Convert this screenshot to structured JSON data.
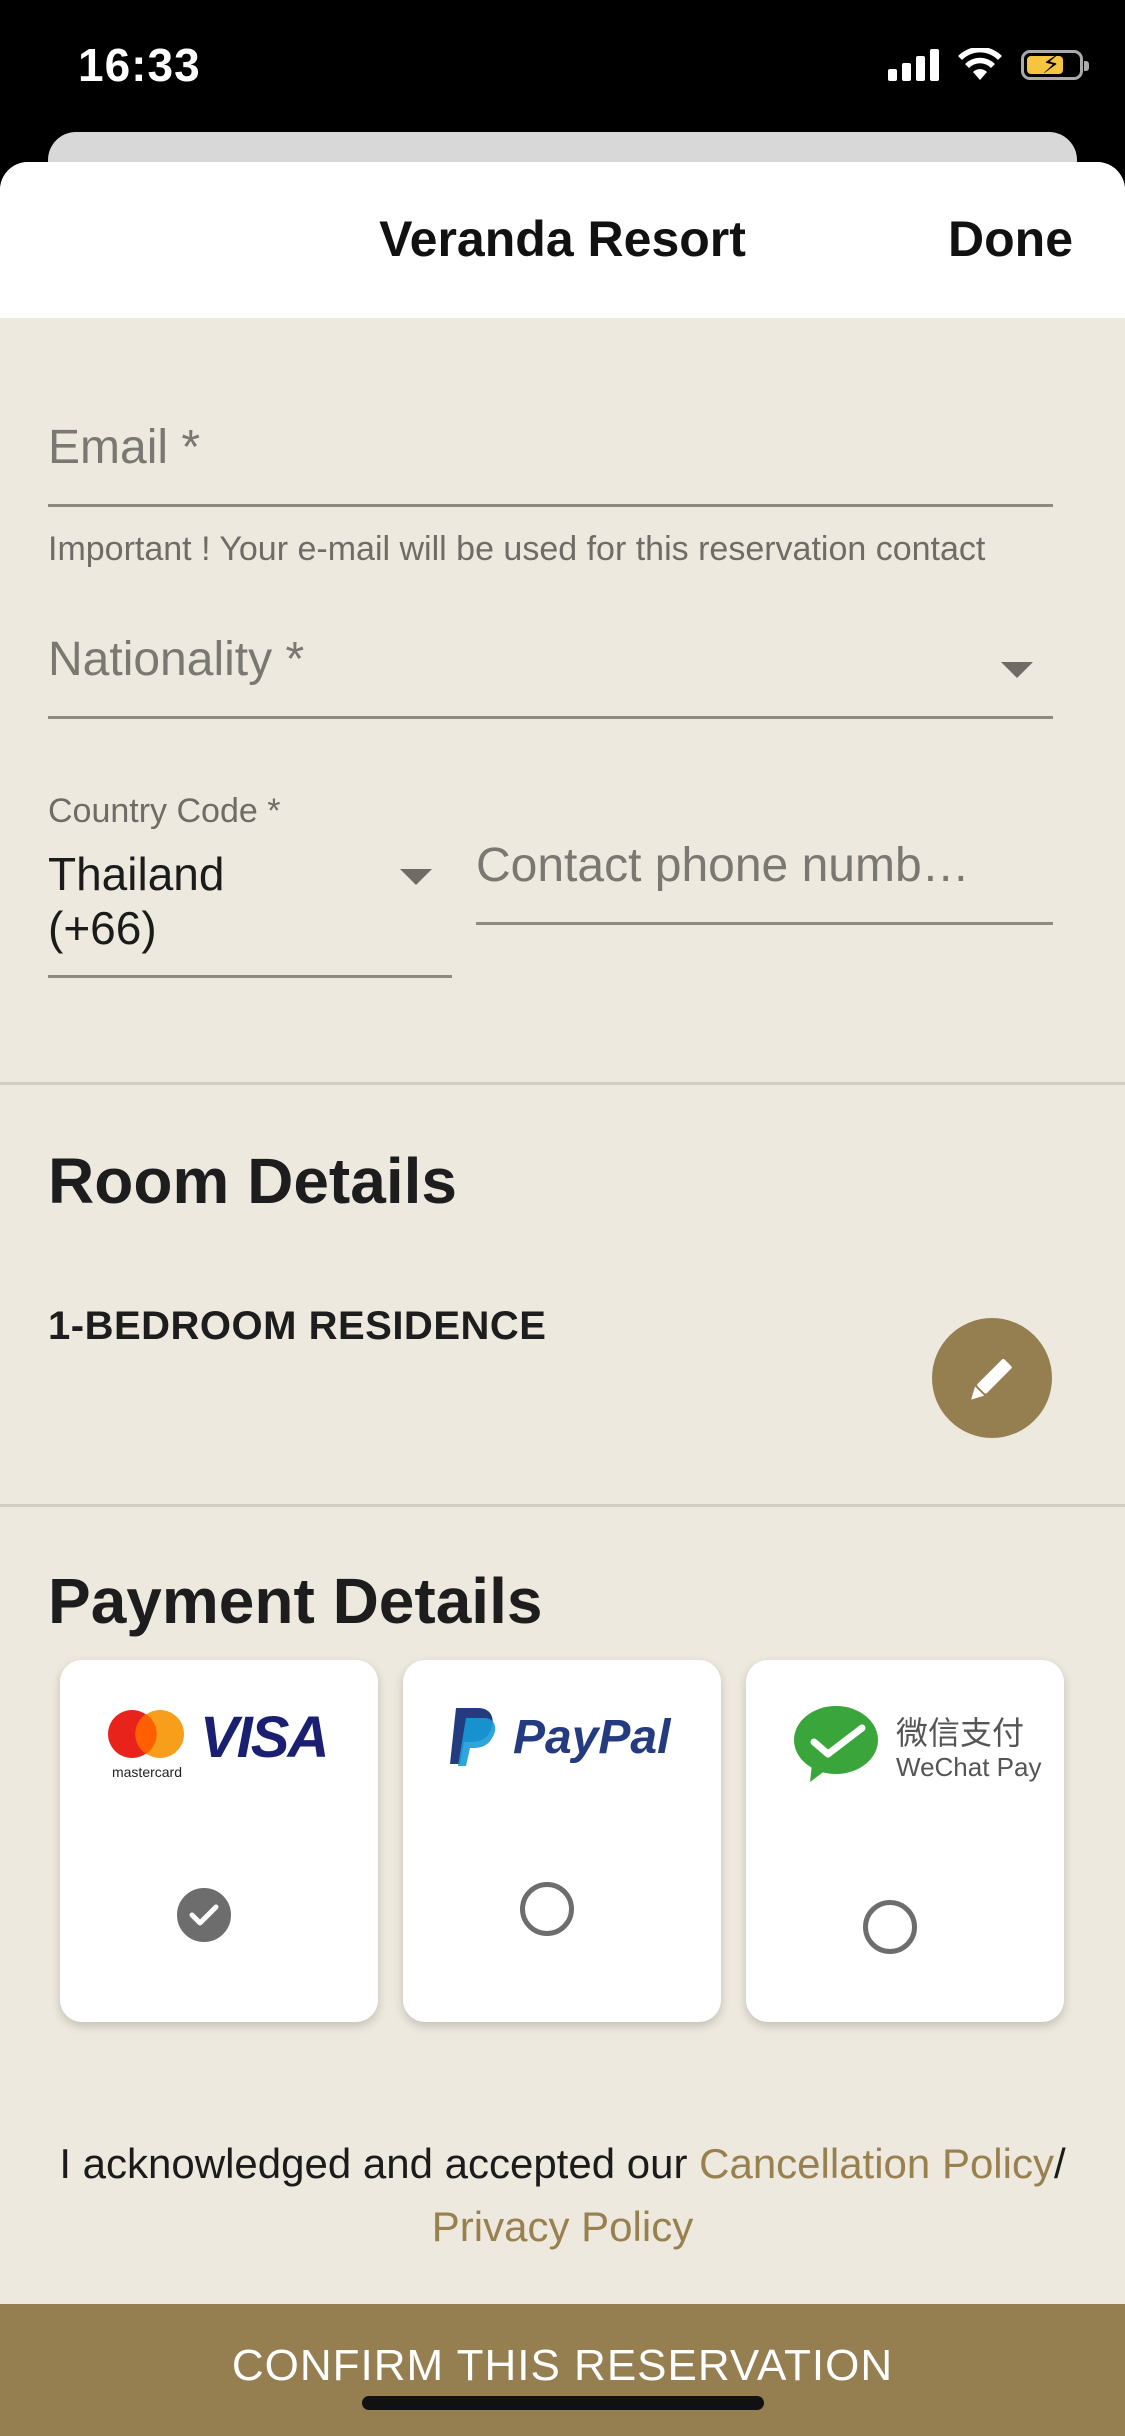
{
  "status_bar": {
    "time": "16:33"
  },
  "nav": {
    "title": "Veranda Resort",
    "done_label": "Done"
  },
  "contact": {
    "email_placeholder": "Email *",
    "email_note": "Important ! Your e-mail will be used for this reservation contact",
    "nationality_placeholder": "Nationality *",
    "country_code_label": "Country Code *",
    "country_code_value_line1": "Thailand",
    "country_code_value_line2": "(+66)",
    "phone_placeholder": "Contact phone numb…"
  },
  "room": {
    "section_title": "Room Details",
    "room_name": "1-BEDROOM RESIDENCE"
  },
  "payment": {
    "section_title": "Payment Details",
    "methods": [
      {
        "name": "Mastercard / Visa",
        "brand_small": "mastercard",
        "brand_main": "VISA",
        "selected": true
      },
      {
        "name": "PayPal",
        "brand_main": "PayPal",
        "selected": false
      },
      {
        "name": "WeChat Pay",
        "brand_cn": "微信支付",
        "brand_en": "WeChat Pay",
        "selected": false
      }
    ]
  },
  "agreement": {
    "text": "I acknowledged and accepted our ",
    "cancellation_link": "Cancellation Policy",
    "separator": "/",
    "privacy_link": "Privacy Policy"
  },
  "confirm_label": "CONFIRM THIS RESERVATION",
  "colors": {
    "accent": "#957f51",
    "background": "#eee9de",
    "link": "#98804f"
  }
}
